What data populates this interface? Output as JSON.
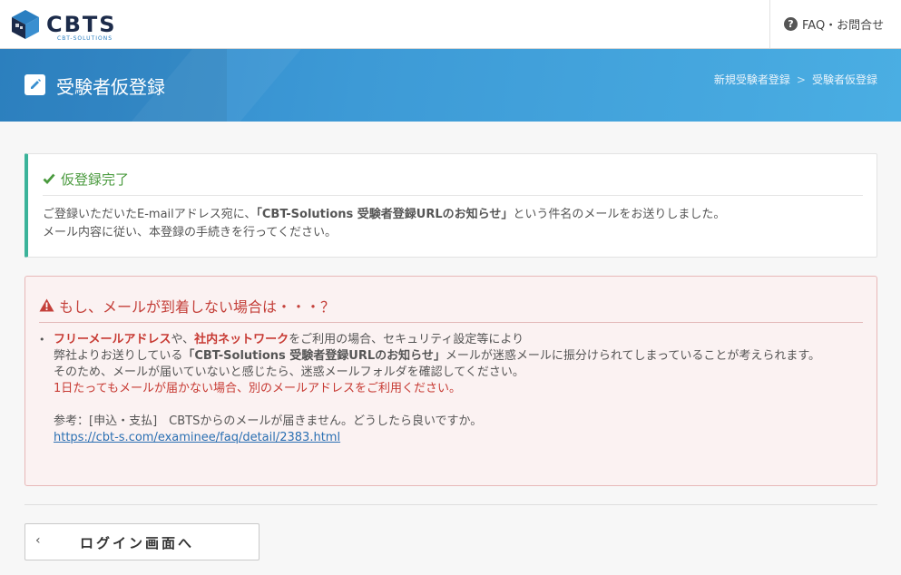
{
  "header": {
    "logo_text": "CBTS",
    "logo_sub": "CBT-SOLUTIONS",
    "faq_label": "FAQ・お問合せ"
  },
  "banner": {
    "title": "受験者仮登録",
    "breadcrumb": [
      "新規受験者登録",
      "受験者仮登録"
    ],
    "breadcrumb_sep": ">"
  },
  "success_panel": {
    "title": "仮登録完了",
    "line1_prefix": "ご登録いただいたE-mailアドレス宛に、",
    "line1_bold": "「CBT-Solutions 受験者登録URLのお知らせ」",
    "line1_suffix": "という件名のメールをお送りしました。",
    "line2": "メール内容に従い、本登録の手続きを行ってください。"
  },
  "warning_panel": {
    "title": "もし、メールが到着しない場合は・・・？",
    "bullet": "•",
    "l1_red1": "フリーメールアドレス",
    "l1_mid": "や、",
    "l1_red2": "社内ネットワーク",
    "l1_tail": "をご利用の場合、セキュリティ設定等により",
    "l2_prefix": "弊社よりお送りしている",
    "l2_bold": "「CBT-Solutions 受験者登録URLのお知らせ」",
    "l2_tail": "メールが迷惑メールに振分けられてしまっていることが考えられます。",
    "l3": "そのため、メールが届いていないと感じたら、迷惑メールフォルダを確認してください。",
    "l4_red": "1日たってもメールが届かない場合、別のメールアドレスをご利用ください。",
    "ref_text": "参考：[申込・支払]　CBTSからのメールが届きません。どうしたら良いですか。",
    "ref_link": "https://cbt-s.com/examinee/faq/detail/2383.html"
  },
  "login_button": {
    "chevron": "‹",
    "label": "ログイン画面へ"
  },
  "colors": {
    "banner_blue": "#3d9ad6",
    "success_green": "#3bb39a",
    "warning_red": "#c4403a"
  }
}
